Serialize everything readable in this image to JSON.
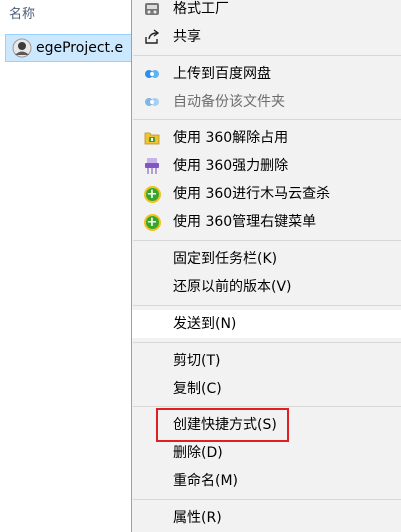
{
  "explorer": {
    "column_header": "名称",
    "file": {
      "name": "egeProject.e"
    }
  },
  "menu": {
    "items": [
      {
        "label": "格式工厂",
        "icon": "format-factory-icon"
      },
      {
        "label": "共享",
        "icon": "share-icon"
      },
      {
        "label": "上传到百度网盘",
        "icon": "baidu-netdisk-icon"
      },
      {
        "label": "自动备份该文件夹",
        "icon": "baidu-netdisk-icon",
        "disabled": true
      },
      {
        "label": "使用 360解除占用",
        "icon": "360-unlock-icon"
      },
      {
        "label": "使用 360强力删除",
        "icon": "360-shred-icon"
      },
      {
        "label": "使用 360进行木马云查杀",
        "icon": "360-scan-icon"
      },
      {
        "label": "使用 360管理右键菜单",
        "icon": "360-menu-manager-icon"
      },
      {
        "label": "固定到任务栏(K)"
      },
      {
        "label": "还原以前的版本(V)"
      },
      {
        "label": "发送到(N)"
      },
      {
        "label": "剪切(T)"
      },
      {
        "label": "复制(C)"
      },
      {
        "label": "创建快捷方式(S)"
      },
      {
        "label": "删除(D)"
      },
      {
        "label": "重命名(M)"
      },
      {
        "label": "属性(R)"
      }
    ]
  },
  "colors": {
    "menu_bg": "#f2f2f2",
    "selection_bg": "#cce8ff",
    "highlight_box": "#e02020",
    "header_text": "#4c607a"
  }
}
